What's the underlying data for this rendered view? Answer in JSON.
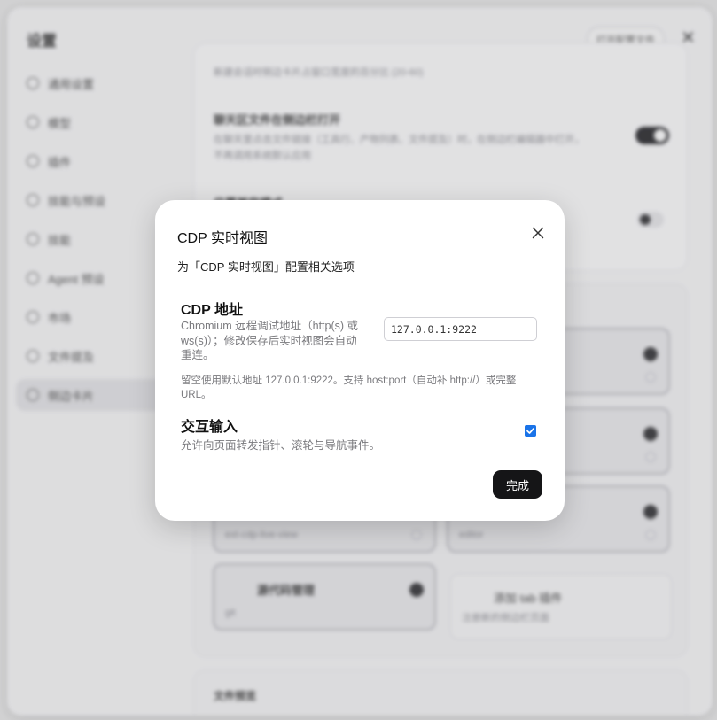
{
  "background": {
    "settings_title": "设置",
    "open_config_label": "打开配置文件",
    "close_glyph": "✕",
    "sidebar_items": [
      {
        "label": "通用设置",
        "icon": "gear-icon"
      },
      {
        "label": "模型",
        "icon": "cube-icon"
      },
      {
        "label": "插件",
        "icon": "puzzle-icon"
      },
      {
        "label": "技能与预设",
        "icon": "gear-icon"
      },
      {
        "label": "技能",
        "icon": "gear-icon"
      },
      {
        "label": "Agent 预设",
        "icon": "robot-icon"
      },
      {
        "label": "市场",
        "icon": "gear-icon"
      },
      {
        "label": "文件提及",
        "icon": "gear-icon"
      },
      {
        "label": "侧边卡片",
        "icon": "panel-icon",
        "active": true
      }
    ],
    "setting_row_1_help": "新建会话时侧边卡片占窗口宽度的百分比 (20-60)",
    "setting_row_2_title": "聊天区文件在侧边栏打开",
    "setting_row_2_help_1": "在聊天里点击文件链接（工具行、产物列表、文件提及）时，在侧边栏编辑器中打开，",
    "setting_row_2_help_2": "不再调用系统默认应用",
    "setting_row_3_title": "位置兼容模式",
    "tile_1_sub": "ext-cdp-live-view",
    "tile_2_sub": "editor",
    "tile_3_title": "源代码管理",
    "tile_3_sub": "git",
    "add_tile_title": "添加 tab 插件",
    "add_tile_sub": "注册新的侧边栏页面",
    "files_section_title": "文件预览"
  },
  "dialog": {
    "title": "CDP 实时视图",
    "description": "为「CDP 实时视图」配置相关选项",
    "address_label": "CDP 地址",
    "address_help": "Chromium 远程调试地址（http(s) 或 ws(s)）；修改保存后实时视图会自动重连。",
    "address_value": "127.0.0.1:9222",
    "address_hint": "留空使用默认地址 127.0.0.1:9222。支持 host:port（自动补 http://）或完整 URL。",
    "interactive_label": "交互输入",
    "interactive_help": "允许向页面转发指针、滚轮与导航事件。",
    "interactive_checked": true,
    "done_label": "完成",
    "accent_color": "#1a73e8"
  }
}
